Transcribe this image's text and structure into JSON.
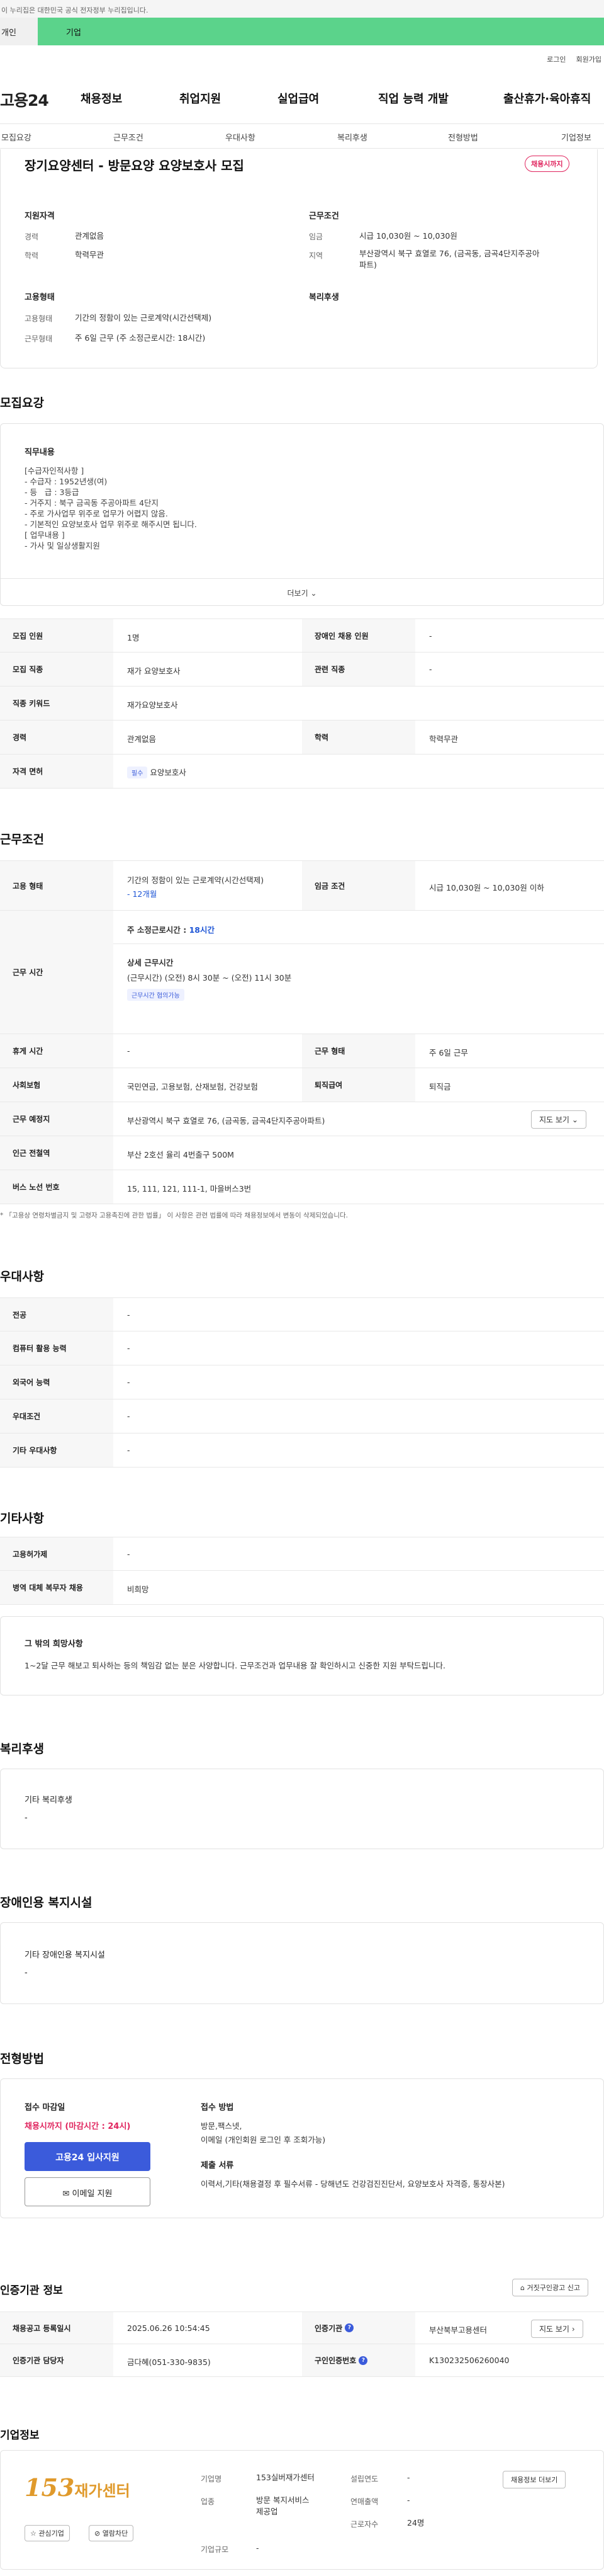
{
  "gov_banner": "이 누리집은 대한민국 공식 전자정부 누리집입니다.",
  "role_tabs": [
    "개인",
    "기업"
  ],
  "util_links": [
    "로그인",
    "회원가입"
  ],
  "logo": "고용24",
  "gnb": [
    "채용정보",
    "취업지원",
    "실업급여",
    "직업 능력 개발",
    "출산휴가·육아휴직"
  ],
  "snb": [
    "모집요강",
    "근무조건",
    "우대사항",
    "복리후생",
    "전형방법",
    "기업정보"
  ],
  "summary": {
    "title": "장기요양센터 - 방문요양 요양보호사 모집",
    "status": "채용시까지",
    "qual_h": "지원자격",
    "exp_k": "경력",
    "exp_v": "관계없음",
    "edu_k": "학력",
    "edu_v": "학력무관",
    "cond_h": "근무조건",
    "wage_k": "임금",
    "wage_v": "시급 10,030원 ~ 10,030원",
    "region_k": "지역",
    "region_v1": "부산광역시 북구 효열로 76, (금곡동, 금곡4단지주공아",
    "region_v2": "파트)",
    "form_h": "고용형태",
    "form_k": "고용형태",
    "form_v": "기간의 정함이 있는 근로계약(시간선택제)",
    "workform_k": "근무형태",
    "workform_v": "주 6일 근무 (주 소정근로시간: 18시간)",
    "welfare_h": "복리후생"
  },
  "recruit": {
    "title": "모집요강",
    "duty_h": "직무내용",
    "duty_lines": [
      "[수급자인적사항 ]",
      "- 수급자 : 1952년생(여)",
      "- 등   급 : 3등급",
      "- 거주지 : 북구 금곡동 주공아파트 4단지",
      "- 주로 가사업무 위주로 업무가 어렵지 않음.",
      "- 기본적인 요양보호사 업무 위주로 해주시면 됩니다.",
      "",
      "[ 업무내용 ]",
      "- 가사 및 일상생활지원"
    ],
    "more": "더보기",
    "headcount_k": "모집 인원",
    "headcount_v": "1명",
    "disabled_k": "장애인 채용 인원",
    "disabled_v": "-",
    "job_k": "모집 직종",
    "job_v": "재가 요양보호사",
    "related_k": "관련 직종",
    "related_v": "-",
    "keyword_k": "직종 키워드",
    "keyword_v": "재가요양보호사",
    "career_k": "경력",
    "career_v": "관계없음",
    "edu_k": "학력",
    "edu_v": "학력무관",
    "license_k": "자격 면허",
    "license_chip": "필수",
    "license_v": "요양보호사"
  },
  "work": {
    "title": "근무조건",
    "form_k": "고용 형태",
    "form_v": "기간의 정함이 있는 근로계약(시간선택제)",
    "form_period": "- 12개월",
    "wage_k": "임금 조건",
    "wage_v": "시급 10,030원 ~ 10,030원 이하",
    "hours_k": "근무 시간",
    "weekly_label": "주 소정근로시간 :",
    "weekly_v": "18시간",
    "detail_h": "상세 근무시간",
    "detail_v": "(근무시간) (오전) 8시 30분 ~ (오전) 11시 30분",
    "nego_chip": "근무시간 협의가능",
    "break_k": "휴게 시간",
    "break_v": "-",
    "type_k": "근무 형태",
    "type_v": "주 6일 근무",
    "insure_k": "사회보험",
    "insure_v": "국민연금, 고용보험, 산재보험, 건강보험",
    "severance_k": "퇴직급여",
    "severance_v": "퇴직금",
    "place_k": "근무 예정지",
    "place_v": "부산광역시 북구 효열로 76, (금곡동, 금곡4단지주공아파트)",
    "map_btn": "지도 보기",
    "subway_k": "인근 전철역",
    "subway_v": "부산 2호선 율리 4번출구 500M",
    "bus_k": "버스 노선 번호",
    "bus_v": "15, 111, 121, 111-1, 마을버스3번",
    "note": "* 「고용상 연령차별금지 및 고령자 고용촉진에 관한 법률」 이 사항은 관련 법률에 따라 채용정보에서 변동이 삭제되었습니다."
  },
  "pref": {
    "title": "우대사항",
    "rows": [
      {
        "k": "전공",
        "v": "-"
      },
      {
        "k": "컴퓨터 활용 능력",
        "v": "-"
      },
      {
        "k": "외국어 능력",
        "v": "-"
      },
      {
        "k": "우대조건",
        "v": "-"
      },
      {
        "k": "기타 우대사항",
        "v": "-"
      }
    ]
  },
  "etc": {
    "title": "기타사항",
    "rows": [
      {
        "k": "고용허가제",
        "v": "-"
      },
      {
        "k": "병역 대체 복무자 채용",
        "v": "비희망"
      }
    ],
    "other_h": "그 밖의 희망사항",
    "other_v": "1~2달 근무 해보고 퇴사하는 등의 책임감 없는 분은 사양합니다. 근무조건과 업무내용 잘 확인하시고 신중한 지원 부탁드립니다."
  },
  "welfare": {
    "title": "복리후생",
    "h": "기타 복리후생",
    "v": "-"
  },
  "disability": {
    "title": "장애인용 복지시설",
    "h": "기타 장애인용 복지시설",
    "v": "-"
  },
  "selection": {
    "title": "전형방법",
    "deadline_h": "접수 마감일",
    "deadline_v": "채용시까지 (마감시간 : 24시)",
    "apply_btn": "고용24 입사지원",
    "email_btn": "이메일 지원",
    "method_h": "접수 방법",
    "method_v1": "방문,팩스넷,",
    "method_v2": "이메일 (개인회원 로그인 후 조회가능)",
    "docs_h": "제출 서류",
    "docs_v": "이력서,기타(채용결정 후 필수서류 - 당해년도 건강검진진단서, 요양보호사 자격증, 통장사본)"
  },
  "cert": {
    "title": "인증기관 정보",
    "report_btn": "거짓구인광고 신고",
    "reg_k": "채용공고 등록일시",
    "reg_v": "2025.06.26 10:54:45",
    "agency_k": "인증기관",
    "agency_v": "부산북부고용센터",
    "map_btn": "지도 보기",
    "manager_k": "인증기관 담당자",
    "manager_v": "금다혜(051-330-9835)",
    "no_k": "구인인증번호",
    "no_v": "K130232506260040"
  },
  "company": {
    "title": "기업정보",
    "logo_num": "153",
    "logo_text": "재가센터",
    "name_k": "기업명",
    "name_v": "153실버재가센터",
    "est_k": "설립연도",
    "est_v": "-",
    "biz_k": "업종",
    "biz_v1": "방문 복지서비스",
    "biz_v2": "제공업",
    "rev_k": "연매출액",
    "rev_v": "-",
    "emp_k": "근로자수",
    "emp_v": "24명",
    "size_k": "기업규모",
    "size_v": "-",
    "fav_btn": "관심기업",
    "block_btn": "열람차단",
    "jobs_btn": "채용정보 더보기"
  },
  "colors": {
    "accent": "#5bd38b",
    "primary": "#3b5bdb",
    "alert": "#e0245e"
  }
}
